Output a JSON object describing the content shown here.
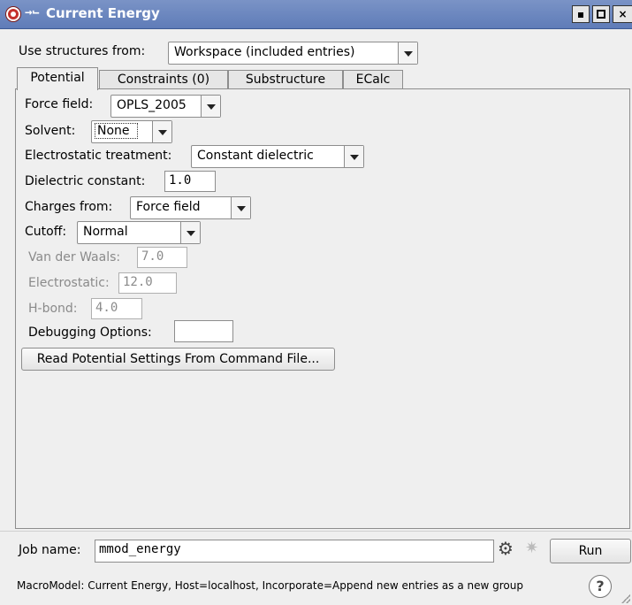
{
  "window": {
    "title": "Current Energy",
    "pin_glyph": "→⌙",
    "controls": {
      "minimize": "▪",
      "maximize": "□",
      "close": "×"
    }
  },
  "source": {
    "label": "Use structures from:",
    "selected": "Workspace (included entries)"
  },
  "tabs": [
    {
      "label": "Potential",
      "active": true
    },
    {
      "label": "Constraints (0)",
      "active": false
    },
    {
      "label": "Substructure",
      "active": false
    },
    {
      "label": "ECalc",
      "active": false
    }
  ],
  "potential": {
    "force_field_label": "Force field:",
    "force_field_value": "OPLS_2005",
    "solvent_label": "Solvent:",
    "solvent_value": "None",
    "electrostatic_label": "Electrostatic treatment:",
    "electrostatic_value": "Constant dielectric",
    "dielectric_label": "Dielectric constant:",
    "dielectric_value": "1.0",
    "charges_label": "Charges from:",
    "charges_value": "Force field",
    "cutoff_label": "Cutoff:",
    "cutoff_value": "Normal",
    "vdw_label": "Van der Waals:",
    "vdw_value": "7.0",
    "electrostatic_cutoff_label": "Electrostatic:",
    "electrostatic_cutoff_value": "12.0",
    "hbond_label": "H-bond:",
    "hbond_value": "4.0",
    "debug_label": "Debugging Options:",
    "debug_value": "",
    "read_button": "Read Potential Settings From Command File..."
  },
  "job": {
    "label": "Job name:",
    "value": "mmod_energy",
    "run_button": "Run",
    "gear_icon": "gear-icon",
    "spinner_icon": "spinner-icon"
  },
  "status": {
    "text": "MacroModel: Current Energy, Host=localhost, Incorporate=Append new entries as a new group",
    "help": "?"
  }
}
